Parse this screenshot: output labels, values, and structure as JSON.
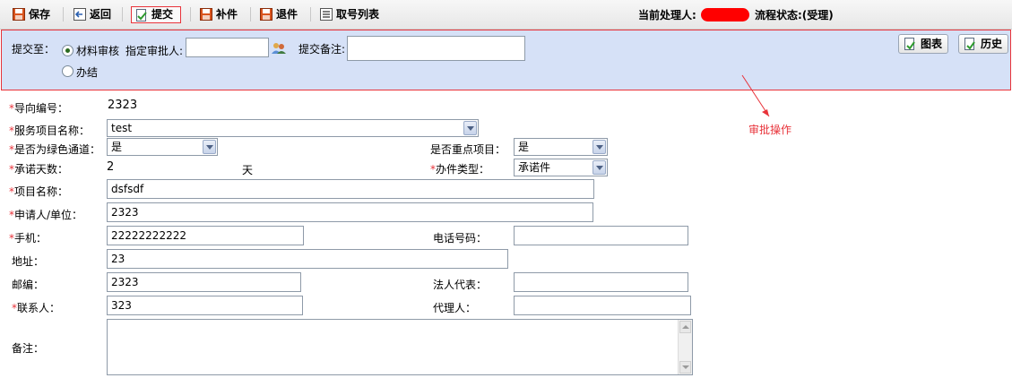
{
  "toolbar": {
    "save_label": "保存",
    "back_label": "返回",
    "submit_label": "提交",
    "supplement_label": "补件",
    "return_label": "退件",
    "number_list_label": "取号列表",
    "current_handler_label": "当前处理人:",
    "flow_status_label": "流程状态:(受理)"
  },
  "submit_panel": {
    "submit_to_label": "提交至：",
    "option_review": "材料审核",
    "option_done": "办结",
    "selected_option": "材料审核",
    "approver_label": "指定审批人:",
    "approver_value": "",
    "note_label": "提交备注:",
    "note_value": "",
    "chart_button": "图表",
    "history_button": "历史"
  },
  "annotation": "审批操作",
  "form": {
    "guide_number_label": "导向编号：",
    "guide_number_value": "2323",
    "service_name_label": "服务项目名称：",
    "service_name_value": "test",
    "green_channel_label": "是否为绿色通道：",
    "green_channel_value": "是",
    "key_project_label": "是否重点项目：",
    "key_project_value": "是",
    "promise_days_label": "承诺天数：",
    "promise_days_value": "2",
    "promise_days_unit": "天",
    "case_type_label": "办件类型：",
    "case_type_value": "承诺件",
    "project_name_label": "项目名称：",
    "project_name_value": "dsfsdf",
    "applicant_label": "申请人/单位：",
    "applicant_value": "2323",
    "mobile_label": "手机：",
    "mobile_value": "22222222222",
    "phone_label": "电话号码：",
    "phone_value": "",
    "address_label": "地址：",
    "address_value": "23",
    "postcode_label": "邮编：",
    "postcode_value": "2323",
    "legal_rep_label": "法人代表：",
    "legal_rep_value": "",
    "contact_label": "联系人：",
    "contact_value": "323",
    "agent_label": "代理人：",
    "agent_value": "",
    "remark_label": "备注：",
    "remark_value": "",
    "required_mark": "*"
  },
  "colors": {
    "panel_bg": "#d6e1f7",
    "highlight_red": "#e8333a",
    "required_red": "#e8333a"
  },
  "icons": {
    "save": "floppy-icon",
    "back": "back-icon",
    "submit": "submit-doc-icon",
    "supplement": "floppy-icon",
    "return": "floppy-icon",
    "number_list": "list-icon",
    "approver_picker": "user-picker-icon",
    "chart": "doc-check-icon",
    "history": "doc-check-icon"
  }
}
